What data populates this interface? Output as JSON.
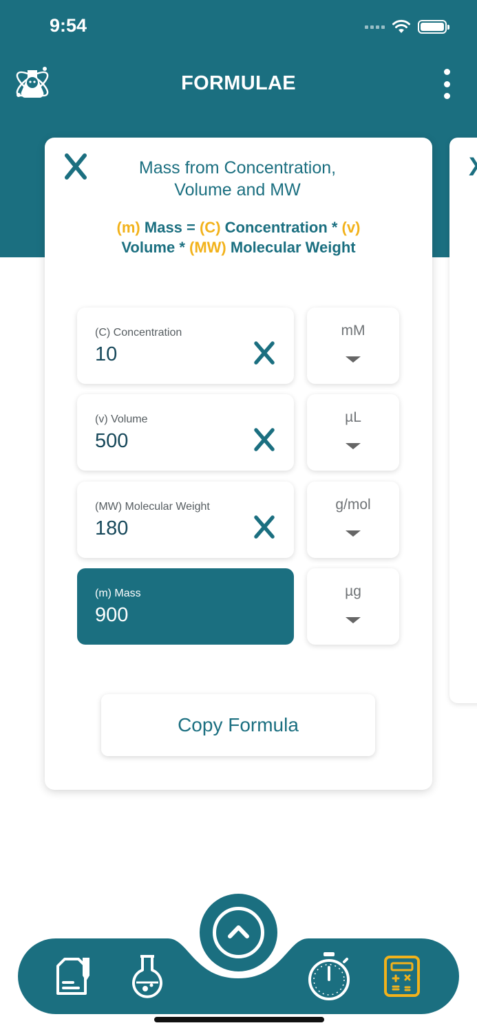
{
  "status_bar": {
    "time": "9:54"
  },
  "header": {
    "title": "FORMULAE",
    "logo_icon": "scientist-logo-icon",
    "menu_icon": "more-vertical-icon"
  },
  "card": {
    "title_line1": "Mass from Concentration,",
    "title_line2": "Volume and MW",
    "formula": {
      "t1": "(m)",
      "t2": " Mass = ",
      "t3": "(C)",
      "t4": " Concentration * ",
      "t5": "(v)",
      "t6": "Volume * ",
      "t7": "(MW)",
      "t8": " Molecular Weight"
    },
    "fields": [
      {
        "label": "(C) Concentration",
        "value": "10",
        "unit": "mM"
      },
      {
        "label": "(v) Volume",
        "value": "500",
        "unit": "µL"
      },
      {
        "label": "(MW) Molecular Weight",
        "value": "180",
        "unit": "g/mol"
      },
      {
        "label": "(m) Mass",
        "value": "900",
        "unit": "µg"
      }
    ],
    "copy_button": "Copy Formula"
  },
  "peek_card": {
    "close": "X"
  },
  "colors": {
    "primary": "#1b6f80",
    "accent": "#f2b21b",
    "background": "#ffffff"
  },
  "bottom_nav": {
    "items": [
      "notes-icon",
      "flask-icon",
      "chevron-up-icon",
      "stopwatch-icon",
      "calculator-icon"
    ],
    "active": "calculator-icon"
  }
}
